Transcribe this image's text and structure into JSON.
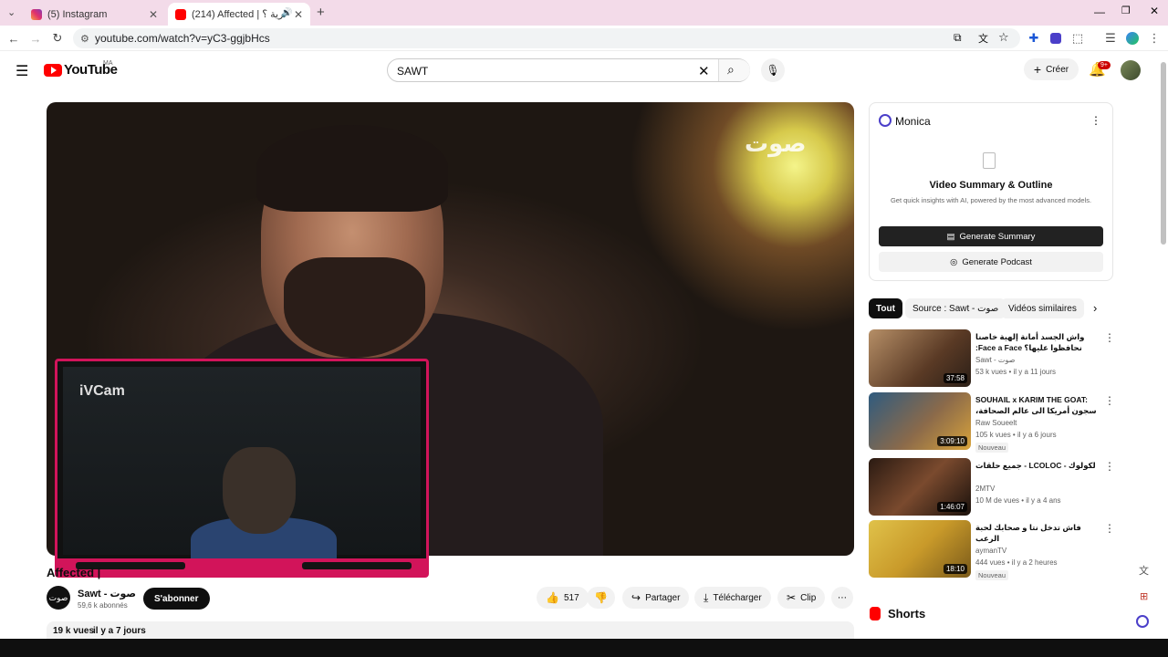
{
  "browser": {
    "tabs": [
      {
        "title": "(5) Instagram",
        "active": false
      },
      {
        "title": "(214) Affected | بكل حرية ؟",
        "active": true
      }
    ],
    "url": "youtube.com/watch?v=yC3-ggjbHcs"
  },
  "youtube": {
    "logo_text": "YouTube",
    "country": "MA",
    "search_value": "SAWT",
    "create_label": "Créer",
    "notif_count": "9+"
  },
  "video": {
    "watermark": "صوت",
    "overlay_label": "iVCam",
    "title": "Affected |",
    "channel_name": "Sawt - صوت",
    "subscribers": "59,6 k abonnés",
    "subscribe_label": "S'abonner",
    "likes": "517",
    "share_label": "Partager",
    "download_label": "Télécharger",
    "clip_label": "Clip",
    "views": "19 k vues",
    "age": "il y a 7 jours"
  },
  "monica": {
    "name": "Monica",
    "heading": "Video Summary & Outline",
    "subtitle": "Get quick insights with AI, powered by the most advanced models.",
    "summary_btn": "Generate Summary",
    "podcast_btn": "Generate Podcast"
  },
  "chips": [
    "Tout",
    "Source : Sawt - صوت",
    "Vidéos similaires"
  ],
  "recommendations": [
    {
      "title": "واش الجسد أمانة إلهية خاصنا نحافظوا عليها؟ Face a Face:",
      "channel": "Sawt - صوت",
      "meta": "53 k vues • il y a 11 jours",
      "duration": "37:58",
      "badge": ""
    },
    {
      "title": "SOUHAIL x KARIM THE GOAT: سجون أمريكا الى عالم الصحافة، التعليم و...",
      "channel": "Raw Soueelt",
      "meta": "105 k vues • il y a 6 jours",
      "duration": "3:09:10",
      "badge": "Nouveau"
    },
    {
      "title": "لكولوك - LCOLOC - جميع حلقات",
      "channel": "2MTV",
      "meta": "10 M de vues • il y a 4 ans",
      "duration": "1:46:07",
      "badge": ""
    },
    {
      "title": "فاش تدخل نتا و صحابك لحبة الرعب",
      "channel": "aymanTV",
      "meta": "444 vues • il y a 2 heures",
      "duration": "18:10",
      "badge": "Nouveau"
    }
  ],
  "shorts_label": "Shorts",
  "colors": {
    "accent_red": "#ff0000",
    "ivcam_border": "#d2145a",
    "tab_strip": "#f3dbe9"
  }
}
